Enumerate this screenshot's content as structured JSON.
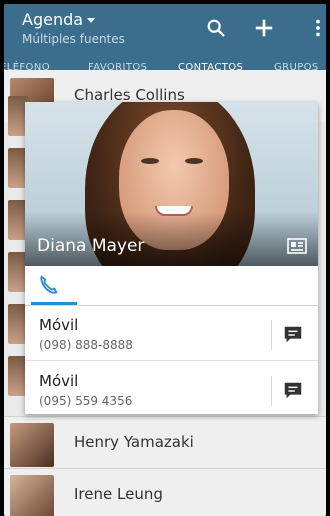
{
  "header": {
    "title": "Agenda",
    "subtitle": "Múltiples fuentes"
  },
  "tabs": [
    {
      "label": "ELÉFONO"
    },
    {
      "label": "FAVORITOS"
    },
    {
      "label": "CONTACTOS"
    },
    {
      "label": "GRUPOS"
    }
  ],
  "background_contacts": [
    {
      "name": "Charles Collins"
    },
    {
      "name": "Henry Yamazaki"
    },
    {
      "name": "Irene Leung"
    }
  ],
  "dialog": {
    "contact_name": "Diana Mayer",
    "numbers": [
      {
        "label": "Móvil",
        "value": "(098) 888-8888"
      },
      {
        "label": "Móvil",
        "value": "(095) 559 4356"
      }
    ]
  },
  "icons": {
    "search": "search-icon",
    "add": "plus-icon",
    "more": "more-vert-icon",
    "card": "contact-card-icon",
    "phone": "phone-icon",
    "message": "message-icon"
  },
  "colors": {
    "header": "#3a6e8c",
    "accent": "#2e8cc8"
  }
}
